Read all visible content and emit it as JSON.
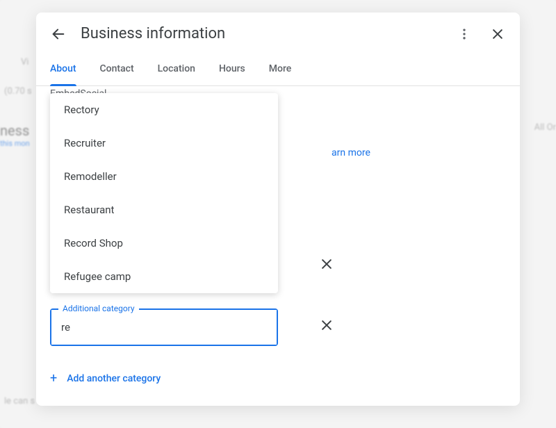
{
  "header": {
    "title": "Business information"
  },
  "tabs": {
    "about": "About",
    "contact": "Contact",
    "location": "Location",
    "hours": "Hours",
    "more": "More"
  },
  "body": {
    "truncated_company": "EmbedSocial",
    "learn_more_partial": "arn more"
  },
  "dropdown": {
    "items": [
      "Rectory",
      "Recruiter",
      "Remodeller",
      "Restaurant",
      "Record Shop",
      "Refugee camp"
    ]
  },
  "input": {
    "label": "Additional category",
    "value": "re"
  },
  "actions": {
    "add_another": "Add another category"
  }
}
